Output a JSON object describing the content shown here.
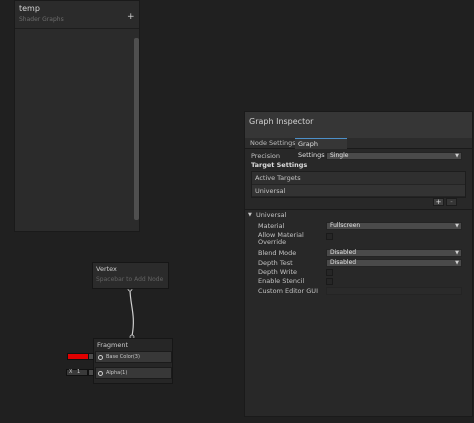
{
  "blackboard": {
    "title": "temp",
    "subtitle": "Shader Graphs",
    "add_glyph": "+"
  },
  "inspector": {
    "title": "Graph Inspector",
    "tabs": [
      "Node Settings",
      "Graph Settings"
    ],
    "active_tab": "Graph Settings",
    "precision_label": "Precision",
    "precision_value": "Single",
    "target_settings_label": "Target Settings",
    "active_targets_label": "Active Targets",
    "targets": [
      "Universal"
    ],
    "add_label": "+",
    "remove_label": "-",
    "section_title": "Universal",
    "properties": {
      "material_label": "Material",
      "material_value": "Fullscreen",
      "allow_override_label_1": "Allow Material",
      "allow_override_label_2": "Override",
      "blend_mode_label": "Blend Mode",
      "blend_mode_value": "Disabled",
      "depth_test_label": "Depth Test",
      "depth_test_value": "Disabled",
      "depth_write_label": "Depth Write",
      "enable_stencil_label": "Enable Stencil",
      "custom_editor_label": "Custom Editor GUI"
    }
  },
  "nodes": {
    "vertex_title": "Vertex",
    "vertex_hint": "Spacebar to Add Node",
    "fragment_title": "Fragment",
    "base_color_label": "Base Color(3)",
    "alpha_label": "Alpha(1)",
    "alpha_axis": "X",
    "alpha_value": "1"
  },
  "colors": {
    "base_color_swatch": "#e00000",
    "accent": "#4d90c9"
  }
}
